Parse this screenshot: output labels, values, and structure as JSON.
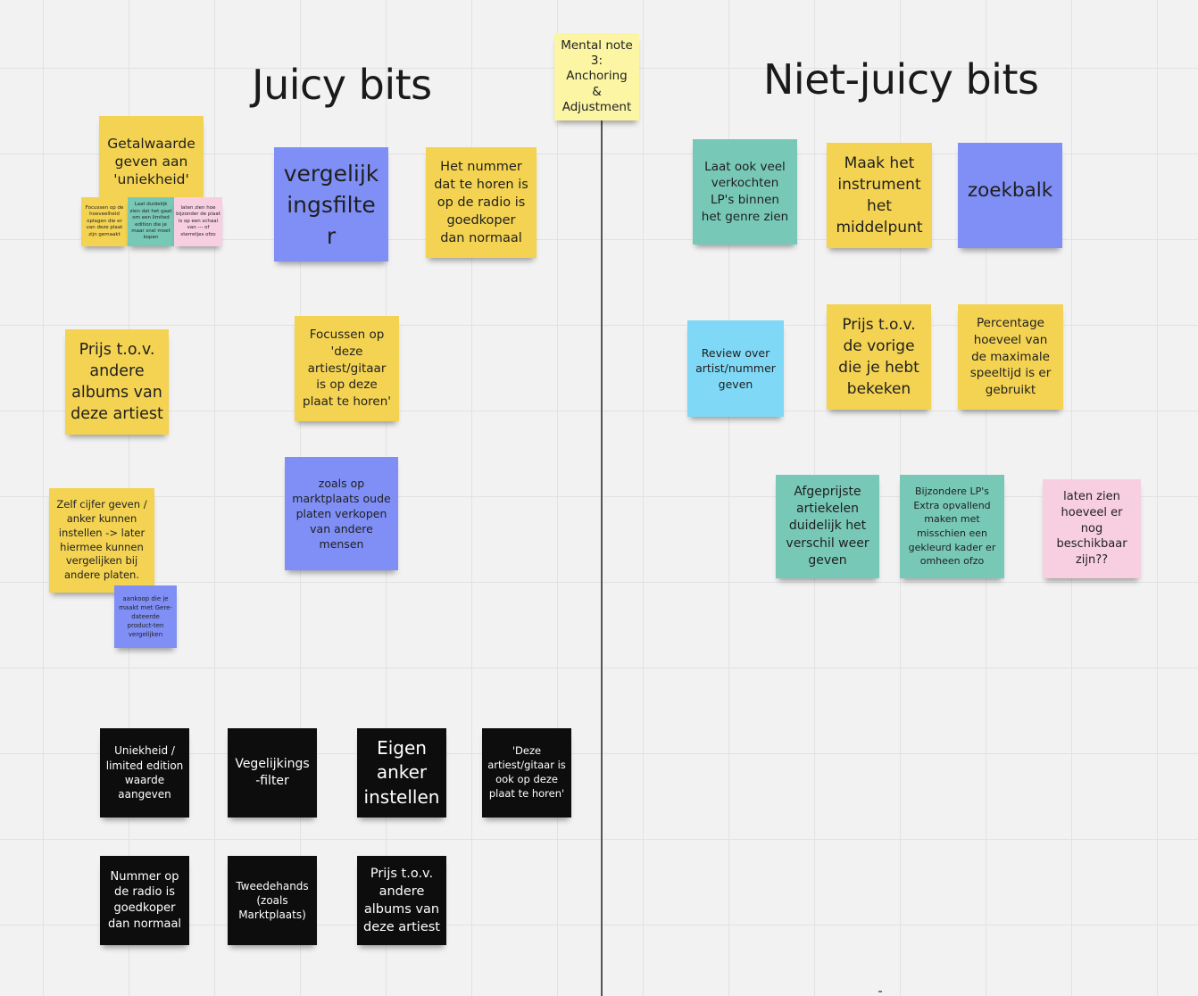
{
  "headings": {
    "juicy": "Juicy bits",
    "niet_juicy": "Niet-juicy bits"
  },
  "notes": {
    "mental_note": "Mental note 3: Anchoring & Adjustment",
    "getalwaarde": "Getalwaarde geven aan 'uniekheid'",
    "small_focussen": "Focussen op de hoeveelheid oplagen die er van deze plaat zijn gemaakt",
    "small_laat_duidelijk": "Laat duidelijk zien dat het gaat om een limited edition die je maar snel moet kopen",
    "small_laten_zien": "laten zien hoe bijzonder de plaat is op een schaal van --- of sterretjes ofzo",
    "vergelijkingsfilter": "vergelijkingsfilter",
    "het_nummer": "Het nummer dat te horen is op de radio is goedkoper dan normaal",
    "prijs_andere_albums": "Prijs t.o.v. andere albums van deze artiest",
    "focussen_artiest": "Focussen op 'deze artiest/gitaar is op deze plaat te horen'",
    "zelf_cijfer": "Zelf cijfer geven / anker kunnen instellen -> later hiermee kunnen vergelijken bij andere platen.",
    "aankoop": "aankoop die je maakt met Gere-dateerde product-ten vergelijken",
    "marktplaats": "zoals op marktplaats oude platen verkopen van andere mensen",
    "laat_ook_veel": "Laat ook veel verkochten LP's binnen het genre zien",
    "maak_instrument": "Maak het instrument het middelpunt",
    "zoekbalk": "zoekbalk",
    "review": "Review over artist/nummer geven",
    "prijs_vorige": "Prijs t.o.v. de vorige die je hebt bekeken",
    "percentage": "Percentage hoeveel van de maximale speeltijd is er gebruikt",
    "afgeprijste": "Afgeprijste artiekelen duidelijk het verschil weer geven",
    "bijzondere": "Bijzondere LP's Extra opvallend maken met misschien een gekleurd kader er omheen ofzo",
    "laten_zien_hoeveel": "laten zien hoeveel er nog beschikbaar zijn??"
  },
  "black_notes": {
    "uniekheid": "Uniekheid / limited edition waarde aangeven",
    "vegelijkings": "Vegelijkings-filter",
    "eigen_anker": "Eigen anker instellen",
    "deze_artiest": "'Deze artiest/gitaar is ook op deze plaat te horen'",
    "nummer_radio": "Nummer op de radio is goedkoper dan normaal",
    "tweedehands": "Tweedehands (zoals Marktplaats)",
    "prijs_tov": "Prijs t.o.v. andere albums van deze artiest"
  }
}
